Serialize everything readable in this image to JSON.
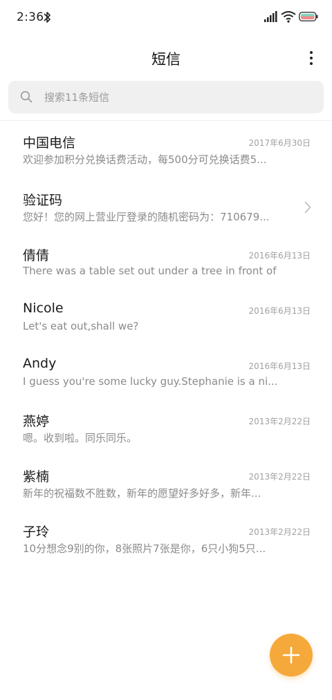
{
  "status_bar": {
    "time": "2:36",
    "icons": [
      "bluetooth-icon",
      "signal-icon",
      "wifi-icon",
      "battery-icon"
    ]
  },
  "header": {
    "title": "短信",
    "menu_icon": "more-vertical-icon"
  },
  "search": {
    "placeholder": "搜索11条短信",
    "icon": "search-icon"
  },
  "messages": [
    {
      "name": "中国电信",
      "date": "2017年6月30日",
      "preview": "欢迎参加积分兑换话费活动，每500分可兑换话费5..."
    },
    {
      "name": "验证码",
      "date": "",
      "preview": "您好！您的网上营业厅登录的随机密码为：710679...",
      "icon": "chevron-right-icon"
    },
    {
      "name": "倩倩",
      "date": "2016年6月13日",
      "preview": "There was a table set out under a tree in front of ..."
    },
    {
      "name": "Nicole",
      "date": "2016年6月13日",
      "preview": "Let's eat out,shall we?"
    },
    {
      "name": "Andy",
      "date": "2016年6月13日",
      "preview": "I guess you're some lucky guy.Stephanie is a ni..."
    },
    {
      "name": "燕婷",
      "date": "2013年2月22日",
      "preview": "嗯。收到啦。同乐同乐。"
    },
    {
      "name": "紫楠",
      "date": "2013年2月22日",
      "preview": "新年的祝福数不胜数，新年的愿望好多好多，新年..."
    },
    {
      "name": "子玲",
      "date": "2013年2月22日",
      "preview": "10分想念9别的你，8张照片7张是你，6只小狗5只..."
    }
  ],
  "fab": {
    "icon": "plus-icon",
    "color": "#f5a93a"
  },
  "colors": {
    "background": "#ffffff",
    "search_bg": "#f0f0f0",
    "accent": "#f5a93a",
    "primary_text": "#1a1a1a",
    "secondary_text": "#8a8a8a"
  }
}
